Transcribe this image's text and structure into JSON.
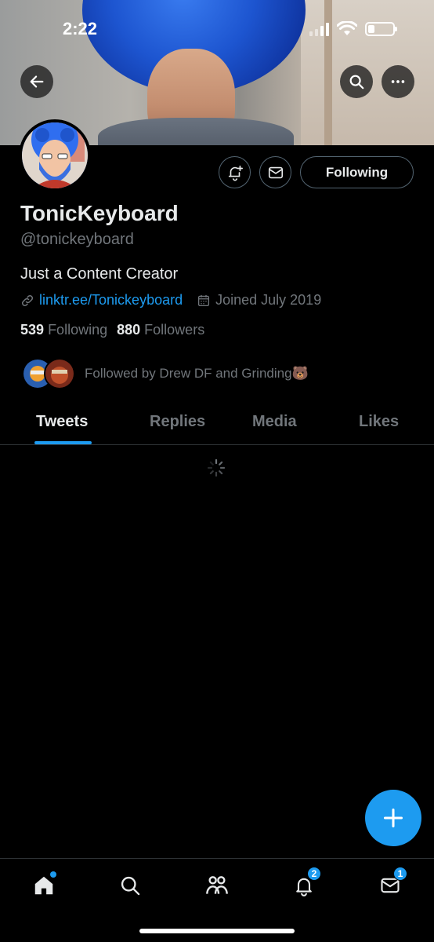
{
  "status_bar": {
    "time": "2:22",
    "battery_level_fraction": 0.25
  },
  "profile": {
    "name": "TonicKeyboard",
    "handle": "@tonickeyboard",
    "bio": "Just a Content Creator",
    "link": "linktr.ee/Tonickeyboard",
    "joined": "Joined July 2019",
    "following_count": "539",
    "following_label": "Following",
    "followers_count": "880",
    "followers_label": "Followers",
    "followed_by": "Followed by Drew DF and Grinding🐻"
  },
  "actions": {
    "follow_button_label": "Following"
  },
  "tabs": [
    {
      "label": "Tweets",
      "active": true
    },
    {
      "label": "Replies",
      "active": false
    },
    {
      "label": "Media",
      "active": false
    },
    {
      "label": "Likes",
      "active": false
    }
  ],
  "bottom_nav": {
    "items": [
      {
        "icon": "home-icon",
        "has_dot": true
      },
      {
        "icon": "search-icon"
      },
      {
        "icon": "communities-icon"
      },
      {
        "icon": "notifications-icon",
        "badge": "2"
      },
      {
        "icon": "messages-icon",
        "badge": "1"
      }
    ]
  },
  "colors": {
    "accent": "#1d9bf0",
    "background": "#000000",
    "muted_text": "#71767b",
    "text": "#e7e9ea"
  }
}
